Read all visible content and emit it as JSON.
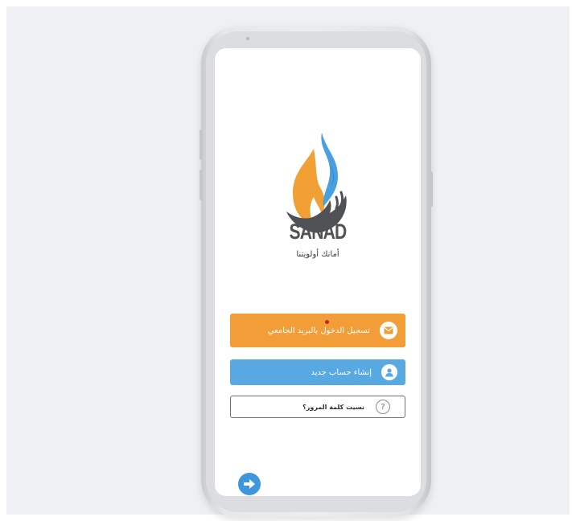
{
  "app": {
    "brand_name": "SANAD",
    "tagline": "أمانك أولويتنا"
  },
  "buttons": {
    "login_label": "تسجيل الدخول بالبريد الجامعي",
    "register_label": "إنشاء حساب جديد",
    "forgot_label": "نسيت كلمة المرور؟",
    "forgot_icon_glyph": "?"
  },
  "icons": {
    "login": "envelope-icon",
    "register": "user-icon",
    "forgot": "question-icon",
    "next": "arrow-right-icon"
  },
  "colors": {
    "page_background": "#eef0f3",
    "login_button": "#f29d38",
    "register_button": "#58a9e2",
    "next_button": "#3f96dc",
    "flame_orange": "#f0a035",
    "flame_blue": "#4a9fe0",
    "hands_gray": "#4f5155",
    "notification_dot": "#d0231a"
  }
}
